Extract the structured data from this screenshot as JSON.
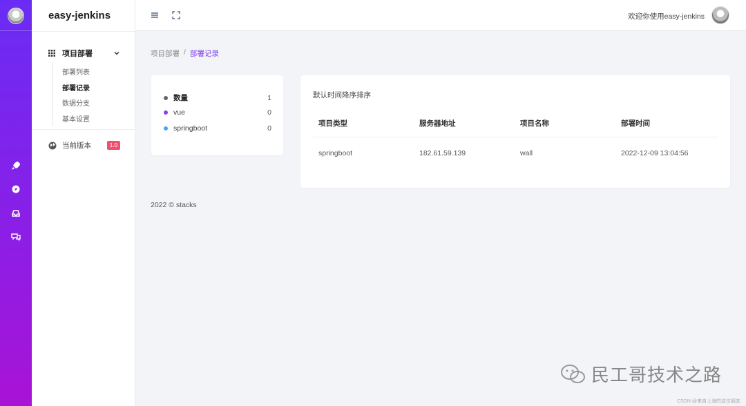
{
  "brand": "easy-jenkins",
  "sidebar": {
    "menu_group": "项目部署",
    "items": [
      "部署列表",
      "部署记录",
      "数据分支",
      "基本设置"
    ],
    "active_index": 1,
    "version_label": "当前版本",
    "version_badge": "1.0"
  },
  "topbar": {
    "welcome": "欢迎你使用easy-jenkins"
  },
  "breadcrumb": {
    "parent": "项目部署",
    "separator": "/",
    "current": "部署记录"
  },
  "stats": {
    "rows": [
      {
        "label": "数量",
        "value": "1",
        "color": "#666666"
      },
      {
        "label": "vue",
        "value": "0",
        "color": "#8b3df0"
      },
      {
        "label": "springboot",
        "value": "0",
        "color": "#4e9ff5"
      }
    ]
  },
  "table": {
    "title": "默认时间降序排序",
    "headers": [
      "项目类型",
      "服务器地址",
      "项目名称",
      "部署时间"
    ],
    "rows": [
      [
        "springboot",
        "182.61.59.139",
        "wall",
        "2022-12-09 13:04:56"
      ]
    ]
  },
  "footer": "2022 © stacks",
  "watermark": {
    "text": "民工哥技术之路",
    "csdn": "CSDN @来自上海的这位朋友"
  },
  "colors": {
    "accent": "#7c3aed",
    "rail_top": "#6a2cf4",
    "rail_bottom": "#a913d6",
    "badge": "#f0506e"
  }
}
